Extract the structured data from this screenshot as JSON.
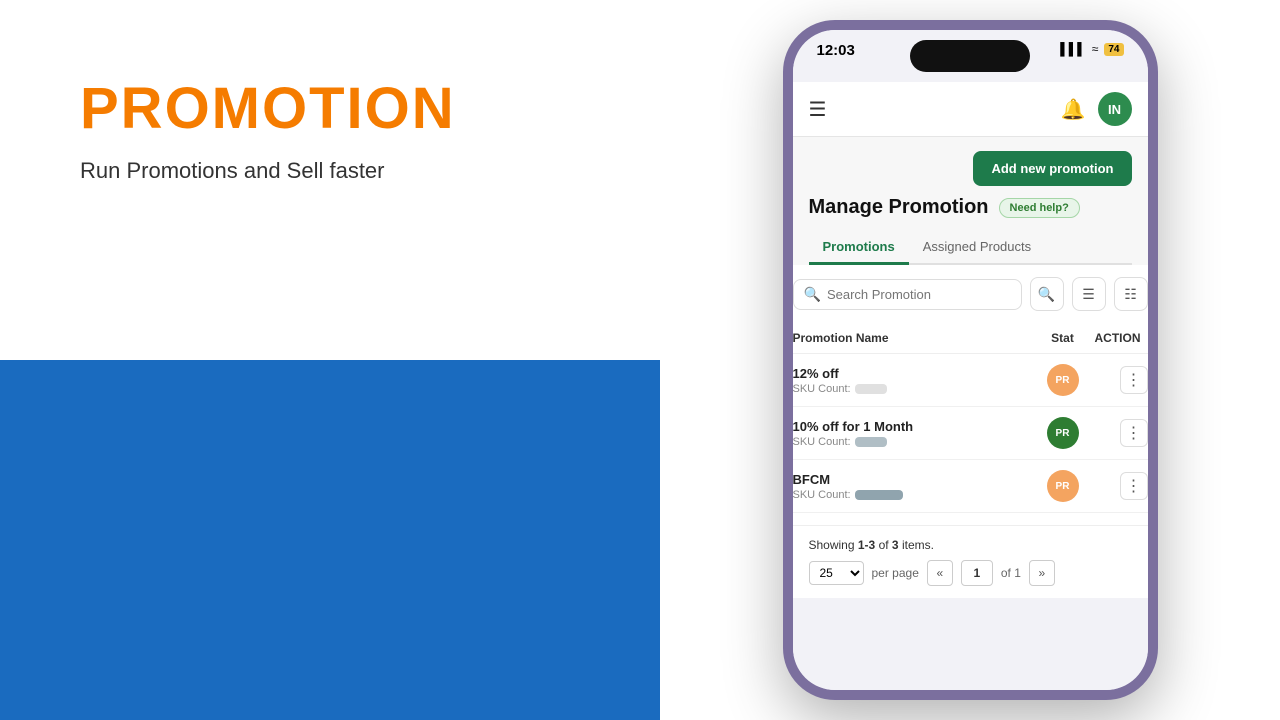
{
  "left": {
    "title": "PROMOTION",
    "subtitle": "Run Promotions and Sell faster"
  },
  "phone": {
    "status_bar": {
      "time": "12:03",
      "battery": "74",
      "signal": "▌▌▌",
      "wifi": "wifi"
    },
    "nav": {
      "user_initials": "IN"
    },
    "header": {
      "add_btn_label": "Add new promotion",
      "manage_title": "Manage Promotion",
      "need_help_label": "Need help?"
    },
    "tabs": [
      {
        "label": "Promotions",
        "active": true
      },
      {
        "label": "Assigned Products",
        "active": false
      }
    ],
    "search": {
      "placeholder": "Search Promotion"
    },
    "table": {
      "columns": [
        {
          "label": "Promotion Name"
        },
        {
          "label": "Stat"
        },
        {
          "label": "ACTION"
        }
      ],
      "rows": [
        {
          "name": "12% off",
          "sku_label": "SKU Count:",
          "status": "PR",
          "status_color": "orange"
        },
        {
          "name": "10% off for 1 Month",
          "sku_label": "SKU Count:",
          "status": "PR",
          "status_color": "green"
        },
        {
          "name": "BFCM",
          "sku_label": "SKU Count:",
          "status": "PR",
          "status_color": "orange"
        }
      ]
    },
    "pagination": {
      "showing_label": "Showing",
      "showing_range": "1-3",
      "showing_of": "of",
      "total": "3",
      "items_label": "items.",
      "page_size": "25",
      "per_page_label": "per page",
      "current_page": "1",
      "of_pages": "of 1"
    }
  }
}
